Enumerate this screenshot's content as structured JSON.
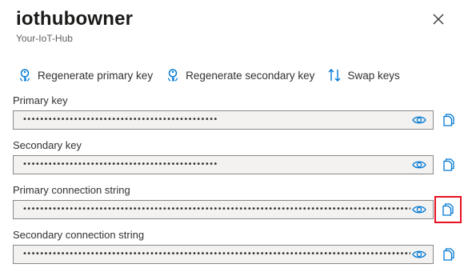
{
  "panel": {
    "title": "iothubowner",
    "subtitle": "Your-IoT-Hub"
  },
  "toolbar": {
    "regen_primary": "Regenerate primary key",
    "regen_secondary": "Regenerate secondary key",
    "swap": "Swap keys"
  },
  "fields": {
    "primary_key": {
      "label": "Primary key",
      "value": "••••••••••••••••••••••••••••••••••••••••••••••"
    },
    "secondary_key": {
      "label": "Secondary key",
      "value": "••••••••••••••••••••••••••••••••••••••••••••••"
    },
    "primary_conn": {
      "label": "Primary connection string",
      "value": "•••••••••••••••••••••••••••••••••••••••••••••••••••••••••••••••••••••••••••••••••••••••••••••••••••••••••••••••••••••••••••••••..."
    },
    "secondary_conn": {
      "label": "Secondary connection string",
      "value": "•••••••••••••••••••••••••••••••••••••••••••••••••••••••••••••••••••••••••••••••••••••••••••••••••••••••••••••••••••••••••••••••..."
    }
  },
  "colors": {
    "accent": "#0078d4",
    "highlight": "#e81123",
    "field_bg": "#f3f2f1"
  }
}
